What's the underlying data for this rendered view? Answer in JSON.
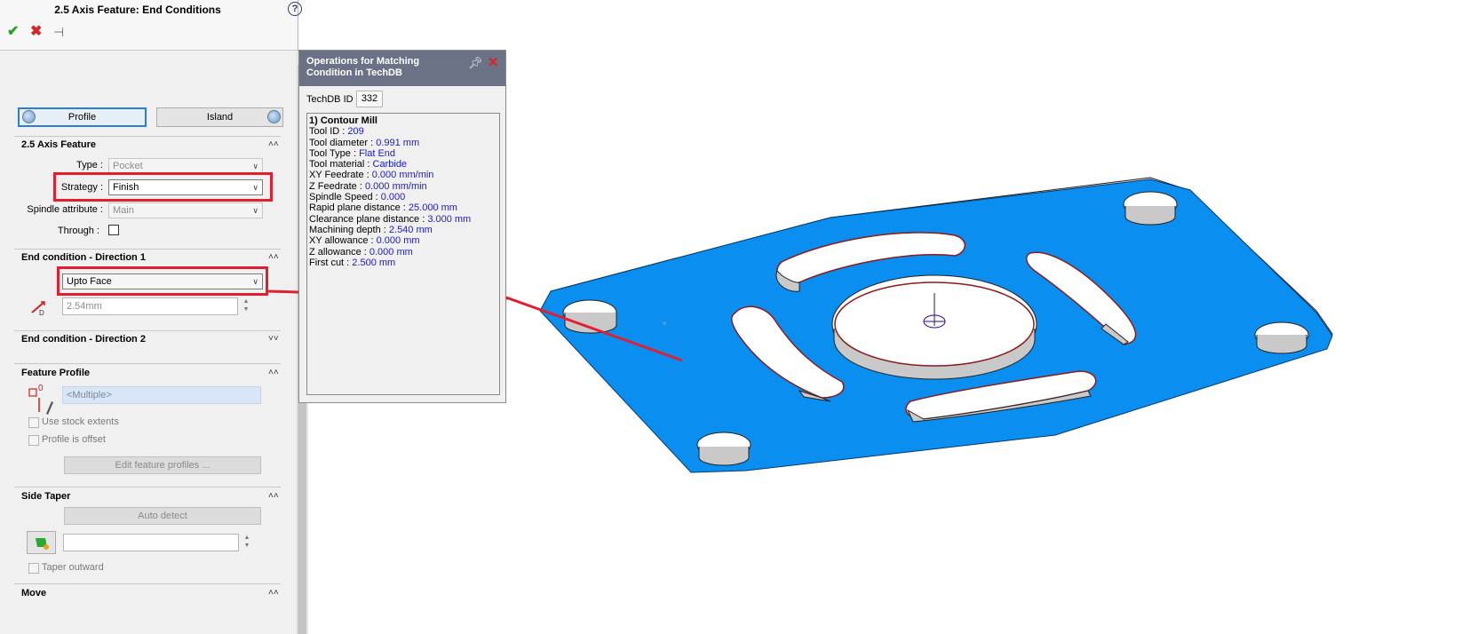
{
  "panel": {
    "title": "2.5 Axis Feature: End Conditions",
    "help_icon": "?",
    "ok_icon": "✔",
    "cancel_icon": "✖",
    "pin_icon": "⊣",
    "profile_button": "Profile",
    "island_button": "Island",
    "feature_section": {
      "title": "2.5 Axis Feature",
      "type_label": "Type :",
      "type_value": "Pocket",
      "strategy_label": "Strategy :",
      "strategy_value": "Finish",
      "spindle_label": "Spindle attribute :",
      "spindle_value": "Main",
      "through_label": "Through :"
    },
    "end_condition_1": {
      "title": "End condition - Direction 1",
      "value": "Upto Face",
      "depth_placeholder": "2.54mm"
    },
    "end_condition_2": {
      "title": "End condition - Direction 2"
    },
    "feature_profile": {
      "title": "Feature Profile",
      "profiles_value": "<Multiple>",
      "use_stock_extents": "Use stock extents",
      "profile_is_offset": "Profile is offset",
      "edit_button": "Edit feature profiles ..."
    },
    "side_taper": {
      "title": "Side Taper",
      "auto_detect_button": "Auto detect",
      "taper_outward": "Taper outward"
    },
    "move": {
      "title": "Move"
    }
  },
  "popup": {
    "title": "Operations for Matching Condition in TechDB",
    "techdb_label": "TechDB ID :",
    "techdb_value": "332",
    "operation_title": "1) Contour Mill",
    "params": [
      {
        "label": "Tool ID : ",
        "value": "209"
      },
      {
        "label": "Tool diameter : ",
        "value": "0.991 mm"
      },
      {
        "label": "Tool Type : ",
        "value": "Flat End"
      },
      {
        "label": "Tool material : ",
        "value": "Carbide"
      },
      {
        "label": "XY Feedrate : ",
        "value": "0.000 mm/min"
      },
      {
        "label": "Z Feedrate : ",
        "value": "0.000 mm/min"
      },
      {
        "label": "Spindle Speed : ",
        "value": "0.000"
      },
      {
        "label": "Rapid plane distance : ",
        "value": "25.000 mm"
      },
      {
        "label": "Clearance plane distance : ",
        "value": "3.000 mm"
      },
      {
        "label": "Machining depth : ",
        "value": "2.540 mm"
      },
      {
        "label": "XY allowance : ",
        "value": "0.000 mm"
      },
      {
        "label": "Z allowance : ",
        "value": "0.000 mm"
      },
      {
        "label": "First cut : ",
        "value": "2.500 mm"
      }
    ]
  },
  "colors": {
    "selected_face": "#0a8ef0",
    "highlight_box": "#e02030",
    "param_value": "#1a1ad0"
  }
}
